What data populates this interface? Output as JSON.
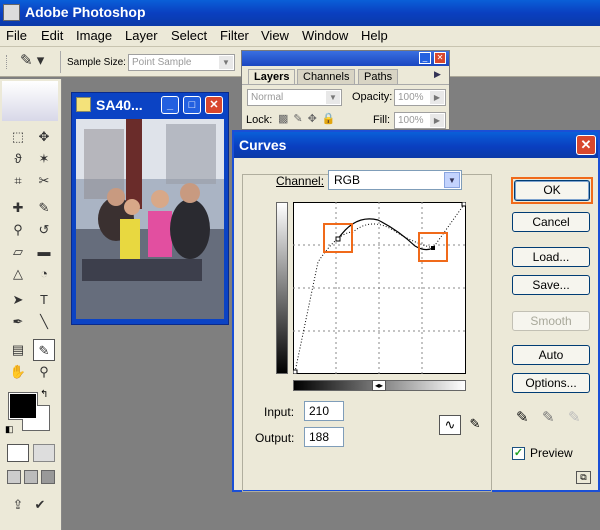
{
  "app": {
    "title": "Adobe Photoshop"
  },
  "menu": [
    "File",
    "Edit",
    "Image",
    "Layer",
    "Select",
    "Filter",
    "View",
    "Window",
    "Help"
  ],
  "options_bar": {
    "sample_size_label": "Sample Size:",
    "sample_size_value": "Point Sample"
  },
  "image_window": {
    "title": "SA40..."
  },
  "layers_panel": {
    "tabs": [
      "Layers",
      "Channels",
      "Paths"
    ],
    "blend_mode": "Normal",
    "opacity_label": "Opacity:",
    "opacity_value": "100%",
    "lock_label": "Lock:",
    "fill_label": "Fill:",
    "fill_value": "100%"
  },
  "curves": {
    "title": "Curves",
    "channel_label": "Channel:",
    "channel_value": "RGB",
    "input_label": "Input:",
    "input_value": "210",
    "output_label": "Output:",
    "output_value": "188",
    "buttons": {
      "ok": "OK",
      "cancel": "Cancel",
      "load": "Load...",
      "save": "Save...",
      "smooth": "Smooth",
      "auto": "Auto",
      "options": "Options..."
    },
    "preview_label": "Preview",
    "preview_checked": true
  },
  "colors": {
    "accent": "#0a3fc0",
    "highlight": "#f06a1a"
  }
}
